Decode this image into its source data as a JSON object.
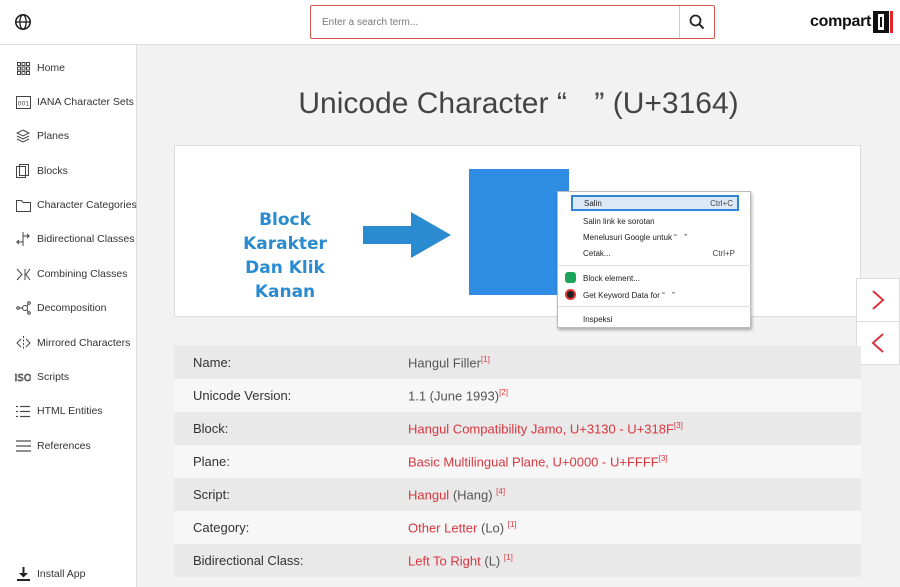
{
  "header": {
    "globe_icon": "globe-icon",
    "search_placeholder": "Enter a search term...",
    "search_icon": "search-icon",
    "logo_text": "compart"
  },
  "sidebar": {
    "items": [
      {
        "label": "Home",
        "icon": "grid-icon"
      },
      {
        "label": "IANA Character Sets",
        "icon": "charset-icon"
      },
      {
        "label": "Planes",
        "icon": "layers-icon"
      },
      {
        "label": "Blocks",
        "icon": "blocks-icon"
      },
      {
        "label": "Character Categories",
        "icon": "folder-icon"
      },
      {
        "label": "Bidirectional Classes",
        "icon": "bidi-icon"
      },
      {
        "label": "Combining Classes",
        "icon": "combining-icon"
      },
      {
        "label": "Decomposition",
        "icon": "decomposition-icon"
      },
      {
        "label": "Mirrored Characters",
        "icon": "mirror-icon"
      },
      {
        "label": "Scripts",
        "icon": "iso-icon"
      },
      {
        "label": "HTML Entities",
        "icon": "list-icon"
      },
      {
        "label": "References",
        "icon": "menu-icon"
      }
    ],
    "install": {
      "label": "Install App",
      "icon": "download-icon"
    }
  },
  "page": {
    "title": "Unicode Character “ㅤ” (U+3164)"
  },
  "illustration": {
    "callout_line1": "Block Karakter",
    "callout_line2": "Dan Klik Kanan",
    "block_color": "#2f8de4",
    "arrow_color": "#2a8bd0"
  },
  "context_menu": {
    "items": [
      {
        "label": "Salin",
        "shortcut": "Ctrl+C",
        "selected": true
      },
      {
        "label": "Salin link ke sorotan",
        "shortcut": ""
      },
      {
        "label": "Menelusuri Google untuk “ㅤ”",
        "shortcut": ""
      },
      {
        "label": "Cetak...",
        "shortcut": "Ctrl+P"
      },
      {
        "label": "Block element...",
        "shortcut": "",
        "icon": "shield-icon"
      },
      {
        "label": "Get Keyword Data for “ㅤ”",
        "shortcut": "",
        "icon": "keyword-icon"
      },
      {
        "label": "Inspeksi",
        "shortcut": ""
      }
    ]
  },
  "nav_buttons": {
    "next_icon": "chevron-right-icon",
    "prev_icon": "chevron-left-icon"
  },
  "properties": {
    "rows": [
      {
        "label": "Name:",
        "value": "Hangul Filler",
        "suffix": "",
        "ref": "[1]",
        "link": false
      },
      {
        "label": "Unicode Version:",
        "value": "1.1 (June 1993)",
        "suffix": "",
        "ref": "[2]",
        "link": false
      },
      {
        "label": "Block:",
        "value": "Hangul Compatibility Jamo, U+3130 - U+318F",
        "suffix": "",
        "ref": "[3]",
        "link": true
      },
      {
        "label": "Plane:",
        "value": "Basic Multilingual Plane, U+0000 - U+FFFF",
        "suffix": "",
        "ref": "[3]",
        "link": true
      },
      {
        "label": "Script:",
        "value": "Hangul",
        "suffix": " (Hang) ",
        "ref": "[4]",
        "link": true
      },
      {
        "label": "Category:",
        "value": "Other Letter",
        "suffix": " (Lo) ",
        "ref": "[1]",
        "link": true
      },
      {
        "label": "Bidirectional Class:",
        "value": "Left To Right",
        "suffix": " (L) ",
        "ref": "[1]",
        "link": true
      }
    ]
  }
}
